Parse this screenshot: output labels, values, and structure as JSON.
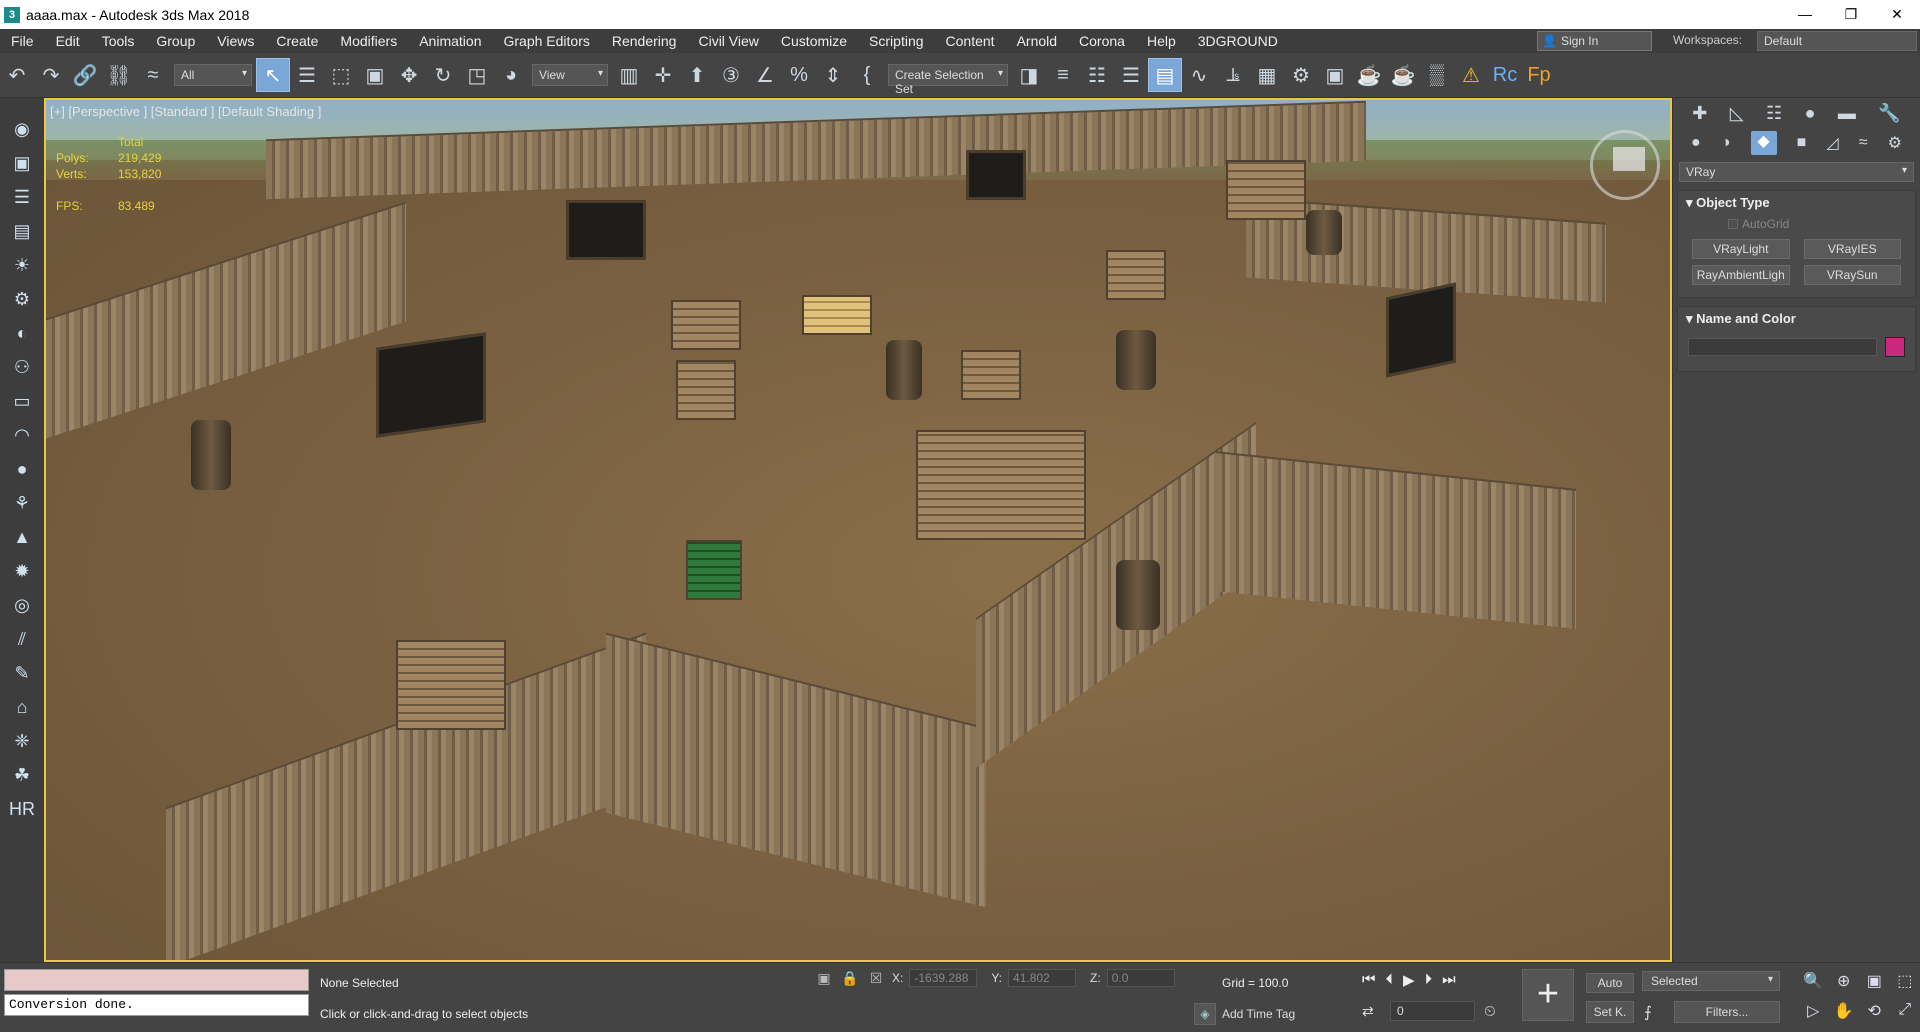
{
  "titlebar": {
    "title": "aaaa.max - Autodesk 3ds Max 2018",
    "app_icon": "3"
  },
  "menu": {
    "items": [
      "File",
      "Edit",
      "Tools",
      "Group",
      "Views",
      "Create",
      "Modifiers",
      "Animation",
      "Graph Editors",
      "Rendering",
      "Civil View",
      "Customize",
      "Scripting",
      "Content",
      "Arnold",
      "Corona",
      "Help",
      "3DGROUND"
    ],
    "signin": "Sign In",
    "workspaces_label": "Workspaces:",
    "workspace_value": "Default"
  },
  "toolbar": {
    "filter_value": "All",
    "refcoord_value": "View",
    "selection_set_value": "Create Selection Set"
  },
  "viewport": {
    "label": "[+] [Perspective ] [Standard ] [Default Shading ]",
    "stats": {
      "total_label": "Total",
      "polys_label": "Polys:",
      "polys_value": "219,429",
      "verts_label": "Verts:",
      "verts_value": "153,820",
      "fps_label": "FPS:",
      "fps_value": "83.489"
    }
  },
  "command_panel": {
    "renderer_select": "VRay",
    "object_type": {
      "title": "Object Type",
      "autogrid": "AutoGrid",
      "buttons": [
        "VRayLight",
        "VRayIES",
        "RayAmbientLigh",
        "VRaySun"
      ]
    },
    "name_color": {
      "title": "Name and Color",
      "color": "#c8297e"
    }
  },
  "statusbar": {
    "listener_output": "Conversion done.",
    "selection_status": "None Selected",
    "prompt": "Click or click-and-drag to select objects",
    "x_label": "X:",
    "x_value": "-1639.288",
    "y_label": "Y:",
    "y_value": "41.802",
    "z_label": "Z:",
    "z_value": "0.0",
    "grid": "Grid = 100.0",
    "add_time_tag": "Add Time Tag",
    "frame_value": "0",
    "auto_key": "Auto",
    "set_key": "Set K.",
    "key_filter_select": "Selected",
    "filters": "Filters..."
  }
}
